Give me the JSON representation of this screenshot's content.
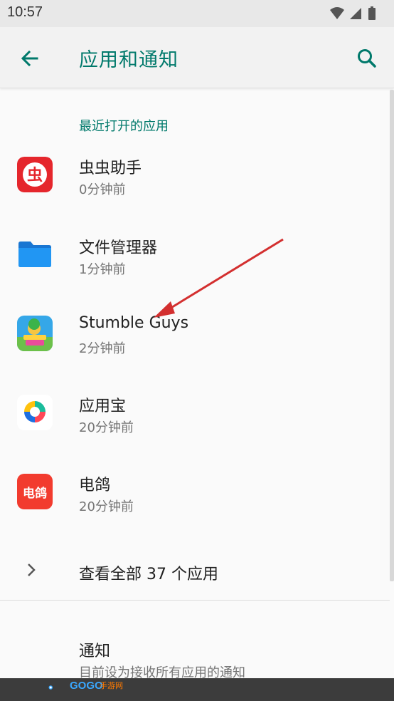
{
  "status_bar": {
    "time": "10:57"
  },
  "toolbar": {
    "title": "应用和通知"
  },
  "recent": {
    "header": "最近打开的应用",
    "apps": [
      {
        "name": "虫虫助手",
        "time": "0分钟前",
        "icon": "chongchong-icon"
      },
      {
        "name": "文件管理器",
        "time": "1分钟前",
        "icon": "folder-icon"
      },
      {
        "name": "Stumble Guys",
        "time": "2分钟前",
        "icon": "stumble-guys-icon"
      },
      {
        "name": "应用宝",
        "time": "20分钟前",
        "icon": "yingyongbao-icon"
      },
      {
        "name": "电鸽",
        "time": "20分钟前",
        "icon": "diange-icon",
        "icon_text": "电鸽"
      }
    ],
    "see_all": "查看全部 37 个应用"
  },
  "notifications": {
    "title": "通知",
    "subtitle": "目前设为接收所有应用的通知"
  },
  "watermark": {
    "brand": "GOGO",
    "suffix": "手游网"
  },
  "colors": {
    "accent": "#00796b",
    "annotation_arrow": "#d32f2f"
  }
}
